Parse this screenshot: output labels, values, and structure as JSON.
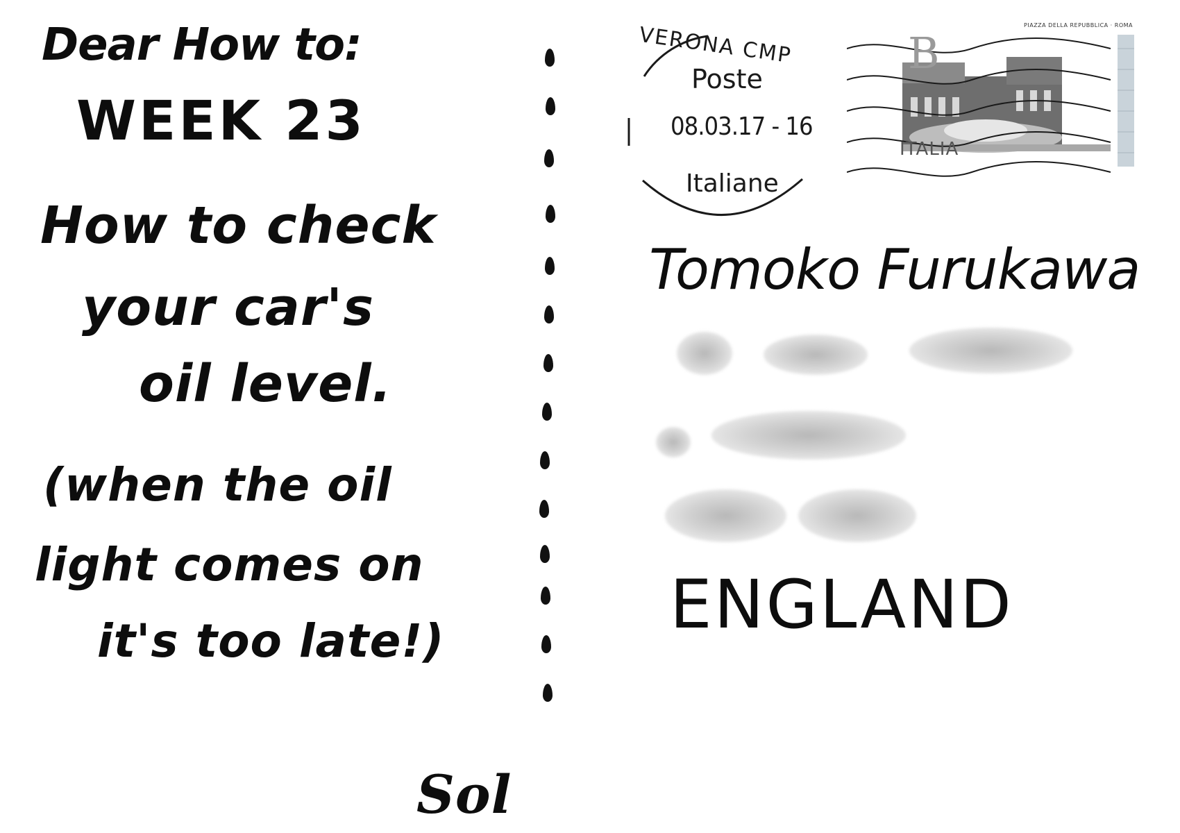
{
  "message": {
    "greeting": "Dear How to:",
    "week": "WEEK  23",
    "title_lines": [
      "How to  check",
      "your  car's",
      "oil  level."
    ],
    "note_lines": [
      "(when  the  oil",
      "light  comes  on",
      "it's  too  late!)"
    ],
    "signature": "Sol"
  },
  "postmark": {
    "city": "VERONA CMP",
    "service": "Poste",
    "date": "08.03.17 - 16",
    "service_suffix": "Italiane"
  },
  "stamp": {
    "value": "B",
    "country": "ITALIA",
    "caption": "PIAZZA DELLA REPUBBLICA · ROMA"
  },
  "address": {
    "recipient": "Tomoko Furukawa",
    "country": "ENGLAND"
  },
  "colors": {
    "ink": "#0d0d0d",
    "paper": "#ffffff",
    "redaction": "#cccccc"
  }
}
